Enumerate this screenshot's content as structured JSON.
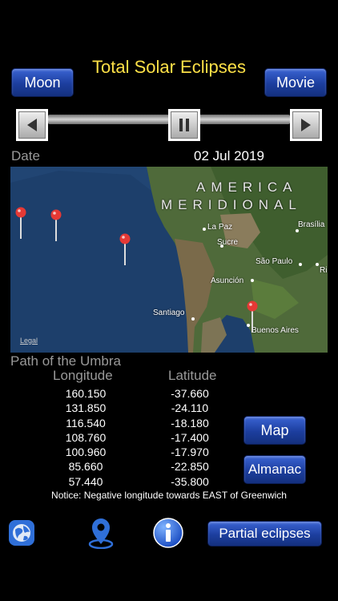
{
  "header": {
    "title": "Total Solar Eclipses",
    "moon_label": "Moon",
    "movie_label": "Movie"
  },
  "date": {
    "label": "Date",
    "value": "02 Jul 2019"
  },
  "map": {
    "continent_line1": "AMERICA",
    "continent_line2": "MERIDIONAL",
    "cities": [
      "La Paz",
      "Brasília",
      "Sucre",
      "São Paulo",
      "Rio",
      "Asunción",
      "Santiago",
      "Buenos Aires"
    ],
    "legal": "Legal"
  },
  "umbra": {
    "title": "Path of the Umbra",
    "longitude_header": "Longitude",
    "latitude_header": "Latitude",
    "rows": [
      {
        "lon": "160.150",
        "lat": "-37.660"
      },
      {
        "lon": "131.850",
        "lat": "-24.110"
      },
      {
        "lon": "116.540",
        "lat": "-18.180"
      },
      {
        "lon": "108.760",
        "lat": "-17.400"
      },
      {
        "lon": "100.960",
        "lat": "-17.970"
      },
      {
        "lon": "85.660",
        "lat": "-22.850"
      },
      {
        "lon": "57.440",
        "lat": "-35.800"
      }
    ]
  },
  "buttons": {
    "map": "Map",
    "almanac": "Almanac",
    "partial": "Partial eclipses"
  },
  "notice": "Notice: Negative longitude towards EAST of Greenwich",
  "colors": {
    "title": "#fde047",
    "button": "#1c3e9e",
    "pin": "#e53935"
  }
}
